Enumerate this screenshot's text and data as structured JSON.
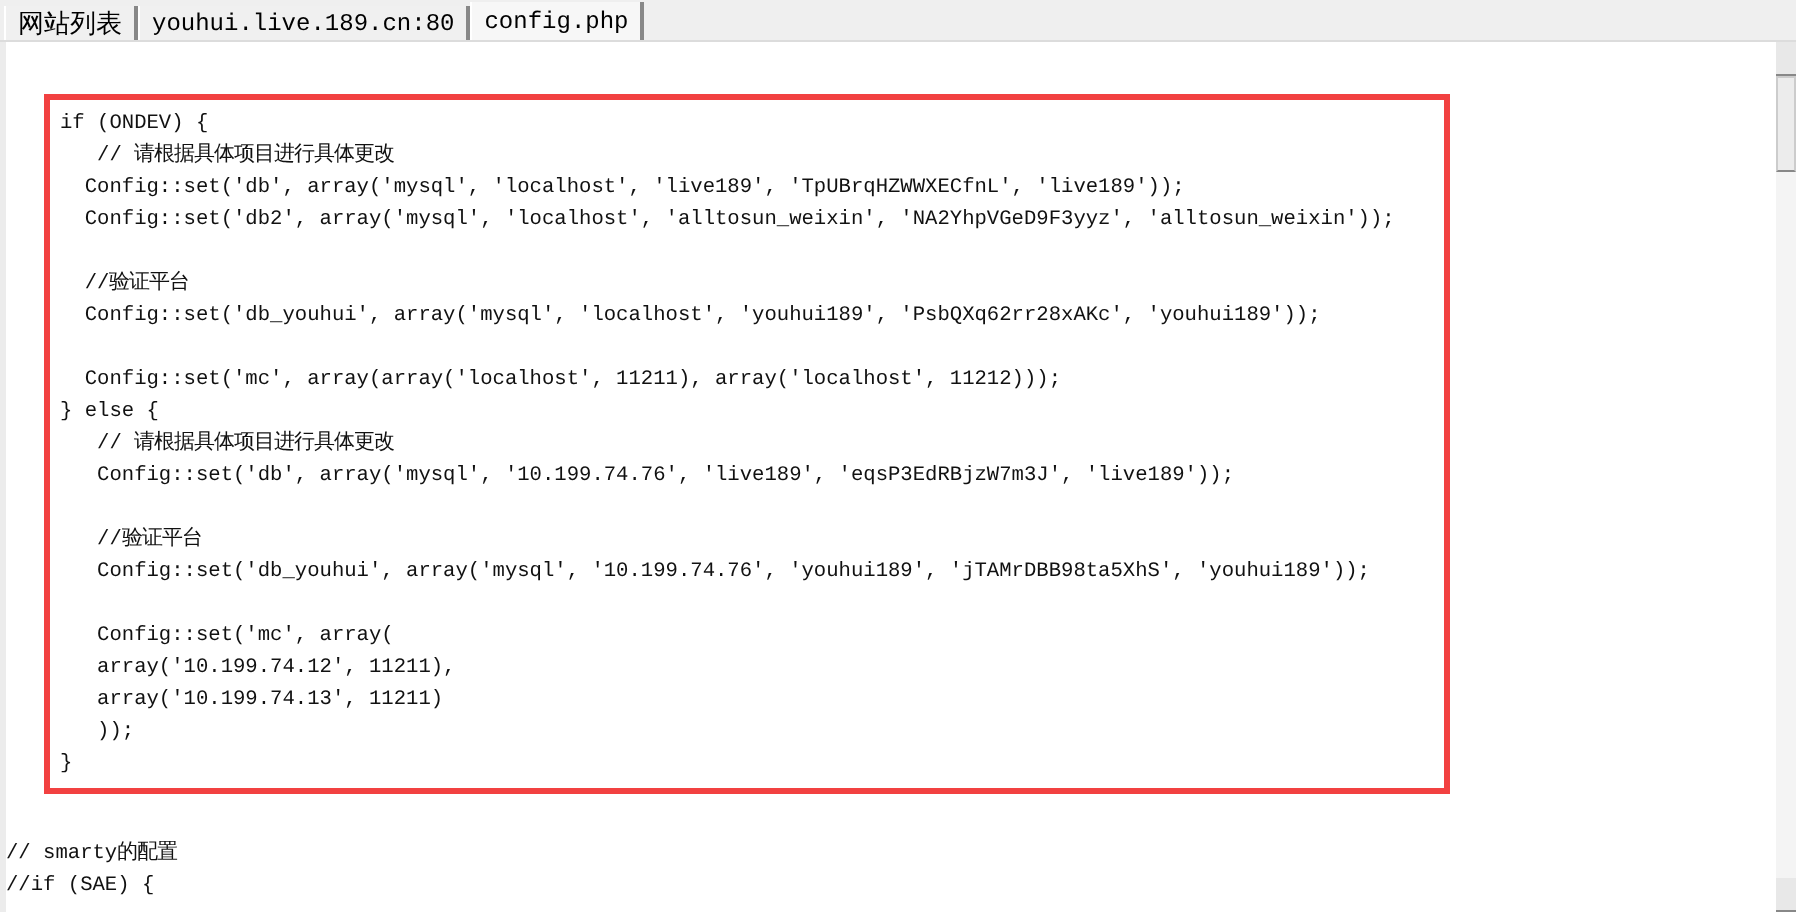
{
  "tabs": [
    {
      "label": "网站列表",
      "selected": false
    },
    {
      "label": "youhui.live.189.cn:80",
      "selected": false
    },
    {
      "label": "config.php",
      "selected": true
    }
  ],
  "highlighted_code": [
    {
      "kind": "code",
      "text": "if (ONDEV) {"
    },
    {
      "kind": "code",
      "text": "   // 请根据具体项目进行具体更改"
    },
    {
      "kind": "code",
      "text": "  Config::set('db', array('mysql', 'localhost', 'live189', 'TpUBrqHZWWXECfnL', 'live189'));"
    },
    {
      "kind": "code",
      "text": "  Config::set('db2', array('mysql', 'localhost', 'alltosun_weixin', 'NA2YhpVGeD9F3yyz', 'alltosun_weixin'));"
    },
    {
      "kind": "blank"
    },
    {
      "kind": "code",
      "text": "  //验证平台"
    },
    {
      "kind": "code",
      "text": "  Config::set('db_youhui', array('mysql', 'localhost', 'youhui189', 'PsbQXq62rr28xAKc', 'youhui189'));"
    },
    {
      "kind": "blank"
    },
    {
      "kind": "code",
      "text": "  Config::set('mc', array(array('localhost', 11211), array('localhost', 11212)));"
    },
    {
      "kind": "code",
      "text": "} else {"
    },
    {
      "kind": "code",
      "text": "   // 请根据具体项目进行具体更改"
    },
    {
      "kind": "code",
      "text": "   Config::set('db', array('mysql', '10.199.74.76', 'live189', 'eqsP3EdRBjzW7m3J', 'live189'));"
    },
    {
      "kind": "blank"
    },
    {
      "kind": "code",
      "text": "   //验证平台"
    },
    {
      "kind": "code",
      "text": "   Config::set('db_youhui', array('mysql', '10.199.74.76', 'youhui189', 'jTAMrDBB98ta5XhS', 'youhui189'));"
    },
    {
      "kind": "blank"
    },
    {
      "kind": "code",
      "text": "   Config::set('mc', array("
    },
    {
      "kind": "code",
      "text": "   array('10.199.74.12', 11211),"
    },
    {
      "kind": "code",
      "text": "   array('10.199.74.13', 11211)"
    },
    {
      "kind": "code",
      "text": "   ));"
    },
    {
      "kind": "code",
      "text": "}"
    }
  ],
  "code_after": [
    {
      "kind": "blank"
    },
    {
      "kind": "code",
      "text": "// smarty的配置"
    },
    {
      "kind": "code",
      "text": "//if (SAE) {"
    }
  ]
}
